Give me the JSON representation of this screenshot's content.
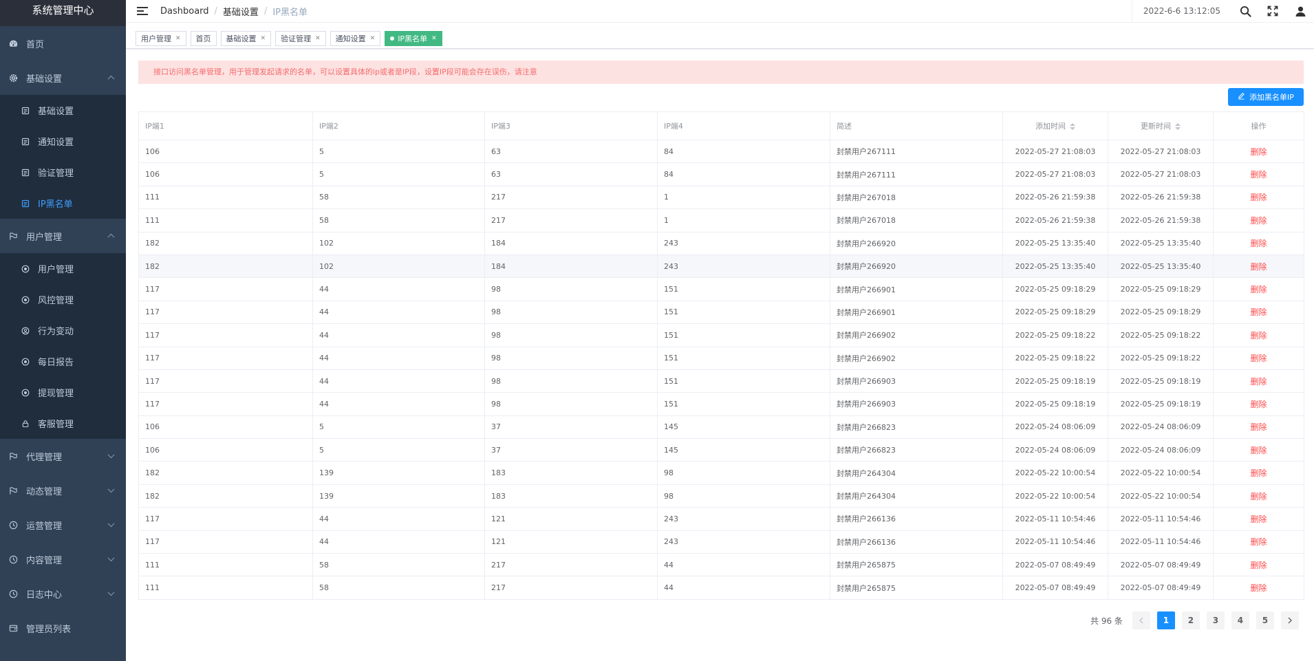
{
  "sidebar": {
    "brand": "系统管理中心",
    "items": [
      {
        "label": "首页",
        "icon": "dashboard-icon"
      },
      {
        "label": "基础设置",
        "icon": "gear-icon",
        "expanded": true,
        "children": [
          "基础设置",
          "通知设置",
          "验证管理",
          "IP黑名单"
        ]
      },
      {
        "label": "用户管理",
        "icon": "flag-icon",
        "expanded": true,
        "children": [
          "用户管理",
          "风控管理",
          "行为变动",
          "每日报告",
          "提现管理",
          "客服管理"
        ]
      },
      {
        "label": "代理管理",
        "icon": "flag-icon"
      },
      {
        "label": "动态管理",
        "icon": "flag-icon"
      },
      {
        "label": "运营管理",
        "icon": "clock-icon"
      },
      {
        "label": "内容管理",
        "icon": "clock-icon"
      },
      {
        "label": "日志中心",
        "icon": "clock-icon"
      },
      {
        "label": "管理员列表",
        "icon": "wallet-icon"
      }
    ],
    "active_submenu": "IP黑名单"
  },
  "header": {
    "breadcrumb": [
      "Dashboard",
      "基础设置",
      "IP黑名单"
    ],
    "datetime": "2022-6-6 13:12:05"
  },
  "tags": [
    {
      "label": "用户管理",
      "closable": true
    },
    {
      "label": "首页",
      "closable": false
    },
    {
      "label": "基础设置",
      "closable": true
    },
    {
      "label": "验证管理",
      "closable": true
    },
    {
      "label": "通知设置",
      "closable": true
    },
    {
      "label": "IP黑名单",
      "closable": true,
      "active": true
    }
  ],
  "notice": "接口访问黑名单管理，用于管理发起请求的名单，可以设置具体的ip或者是IP段，设置IP段可能会存在误伤，请注意",
  "add_button_label": "添加黑名单IP",
  "table": {
    "columns": [
      "IP端1",
      "IP端2",
      "IP端3",
      "IP端4",
      "简述",
      "添加时间",
      "更新时间",
      "操作"
    ],
    "delete_label": "删除",
    "rows": [
      [
        "106",
        "5",
        "63",
        "84",
        "封禁用户267111",
        "2022-05-27 21:08:03",
        "2022-05-27 21:08:03"
      ],
      [
        "106",
        "5",
        "63",
        "84",
        "封禁用户267111",
        "2022-05-27 21:08:03",
        "2022-05-27 21:08:03"
      ],
      [
        "111",
        "58",
        "217",
        "1",
        "封禁用户267018",
        "2022-05-26 21:59:38",
        "2022-05-26 21:59:38"
      ],
      [
        "111",
        "58",
        "217",
        "1",
        "封禁用户267018",
        "2022-05-26 21:59:38",
        "2022-05-26 21:59:38"
      ],
      [
        "182",
        "102",
        "184",
        "243",
        "封禁用户266920",
        "2022-05-25 13:35:40",
        "2022-05-25 13:35:40"
      ],
      [
        "182",
        "102",
        "184",
        "243",
        "封禁用户266920",
        "2022-05-25 13:35:40",
        "2022-05-25 13:35:40"
      ],
      [
        "117",
        "44",
        "98",
        "151",
        "封禁用户266901",
        "2022-05-25 09:18:29",
        "2022-05-25 09:18:29"
      ],
      [
        "117",
        "44",
        "98",
        "151",
        "封禁用户266901",
        "2022-05-25 09:18:29",
        "2022-05-25 09:18:29"
      ],
      [
        "117",
        "44",
        "98",
        "151",
        "封禁用户266902",
        "2022-05-25 09:18:22",
        "2022-05-25 09:18:22"
      ],
      [
        "117",
        "44",
        "98",
        "151",
        "封禁用户266902",
        "2022-05-25 09:18:22",
        "2022-05-25 09:18:22"
      ],
      [
        "117",
        "44",
        "98",
        "151",
        "封禁用户266903",
        "2022-05-25 09:18:19",
        "2022-05-25 09:18:19"
      ],
      [
        "117",
        "44",
        "98",
        "151",
        "封禁用户266903",
        "2022-05-25 09:18:19",
        "2022-05-25 09:18:19"
      ],
      [
        "106",
        "5",
        "37",
        "145",
        "封禁用户266823",
        "2022-05-24 08:06:09",
        "2022-05-24 08:06:09"
      ],
      [
        "106",
        "5",
        "37",
        "145",
        "封禁用户266823",
        "2022-05-24 08:06:09",
        "2022-05-24 08:06:09"
      ],
      [
        "182",
        "139",
        "183",
        "98",
        "封禁用户264304",
        "2022-05-22 10:00:54",
        "2022-05-22 10:00:54"
      ],
      [
        "182",
        "139",
        "183",
        "98",
        "封禁用户264304",
        "2022-05-22 10:00:54",
        "2022-05-22 10:00:54"
      ],
      [
        "117",
        "44",
        "121",
        "243",
        "封禁用户266136",
        "2022-05-11 10:54:46",
        "2022-05-11 10:54:46"
      ],
      [
        "117",
        "44",
        "121",
        "243",
        "封禁用户266136",
        "2022-05-11 10:54:46",
        "2022-05-11 10:54:46"
      ],
      [
        "111",
        "58",
        "217",
        "44",
        "封禁用户265875",
        "2022-05-07 08:49:49",
        "2022-05-07 08:49:49"
      ],
      [
        "111",
        "58",
        "217",
        "44",
        "封禁用户265875",
        "2022-05-07 08:49:49",
        "2022-05-07 08:49:49"
      ]
    ]
  },
  "pagination": {
    "total_text": "共 96 条",
    "pages": [
      "1",
      "2",
      "3",
      "4",
      "5"
    ],
    "current": "1"
  },
  "colors": {
    "sidebar_bg": "#304156",
    "submenu_bg": "#1f2d3d",
    "active_link": "#409eff",
    "active_tag": "#42b983",
    "primary": "#1890ff",
    "danger": "#ff4949",
    "notice_bg": "#fde2e2"
  }
}
